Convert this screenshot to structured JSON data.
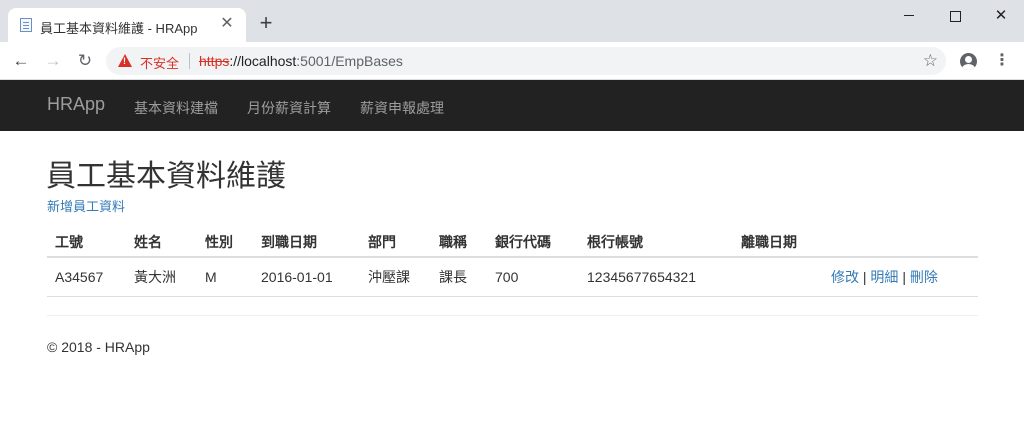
{
  "browser": {
    "tab_title": "員工基本資料維護 - HRApp",
    "tab_close": "✕",
    "new_tab": "+",
    "win_close": "✕",
    "nav_back": "←",
    "nav_forward": "→",
    "nav_reload": "↻",
    "security_label": "不安全",
    "url_scheme": "https",
    "url_host": "://localhost",
    "url_path": ":5001/EmpBases",
    "star": "☆",
    "menu": "⋮"
  },
  "navbar": {
    "brand": "HRApp",
    "links": [
      "基本資料建檔",
      "月份薪資計算",
      "薪資申報處理"
    ]
  },
  "page": {
    "title": "員工基本資料維護",
    "create_link": "新增員工資料"
  },
  "table": {
    "headers": [
      "工號",
      "姓名",
      "性別",
      "到職日期",
      "部門",
      "職稱",
      "銀行代碼",
      "根行帳號",
      "離職日期",
      ""
    ],
    "rows": [
      {
        "cells": [
          "A34567",
          "黃大洲",
          "M",
          "2016-01-01",
          "沖壓課",
          "課長",
          "700",
          "12345677654321",
          ""
        ],
        "actions": {
          "edit": "修改",
          "details": "明細",
          "delete": "刪除",
          "separator": "|"
        }
      }
    ]
  },
  "footer": {
    "text": "© 2018 - HRApp"
  },
  "colors": {
    "navbar_bg": "#222222",
    "link": "#337ab7",
    "insecure": "#d93025"
  }
}
